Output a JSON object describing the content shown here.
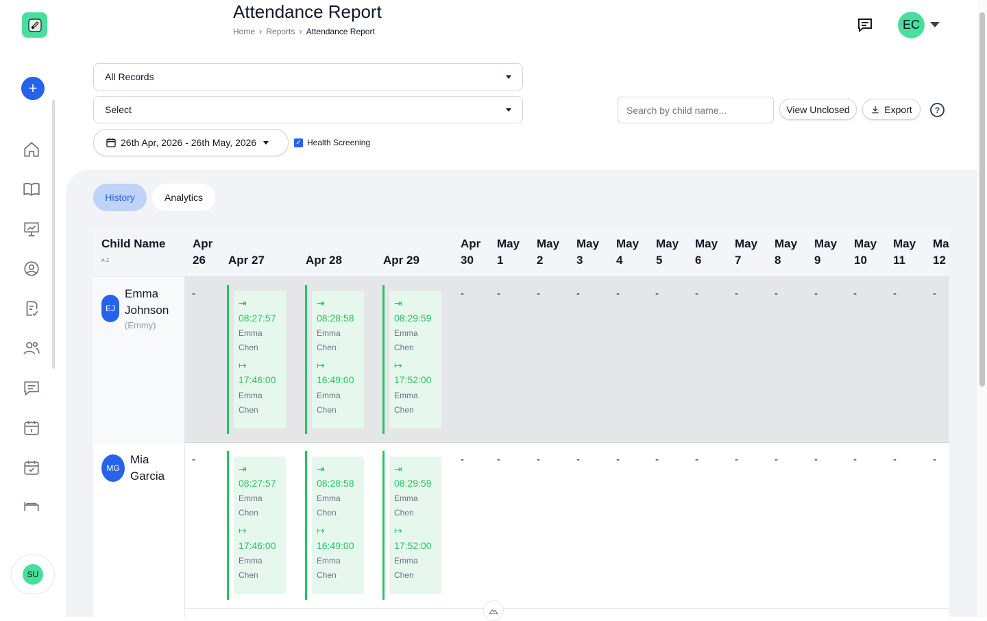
{
  "header": {
    "title": "Attendance Report",
    "breadcrumb": [
      "Home",
      "Reports",
      "Attendance Report"
    ],
    "user_initials": "EC"
  },
  "filters": {
    "records_select": "All Records",
    "class_select": "Select",
    "date_range": "26th Apr, 2026 - 26th May, 2026",
    "health_screening_label": "Health Screening",
    "health_screening_checked": true,
    "search_placeholder": "Search by child name...",
    "view_unclosed_label": "View Unclosed",
    "export_label": "Export"
  },
  "tabs": [
    "History",
    "Analytics"
  ],
  "table": {
    "name_header": "Child Name",
    "sort_hint": "A-Z",
    "columns": [
      "Apr\n26",
      "Apr 27",
      "Apr 28",
      "Apr 29",
      "Apr\n30",
      "May\n1",
      "May\n2",
      "May\n3",
      "May\n4",
      "May\n5",
      "May\n6",
      "May\n7",
      "May\n8",
      "May\n9",
      "May\n10",
      "May\n11",
      "Ma\n12"
    ],
    "rows": [
      {
        "initials": "EJ",
        "name": "Emma\nJohnson",
        "nickname": "(Emmy)",
        "records": [
          {
            "in": "08:27:57",
            "in_by": "Emma\nChen",
            "out": "17:46:00",
            "out_by": "Emma\nChen"
          },
          {
            "in": "08:28:58",
            "in_by": "Emma\nChen",
            "out": "16:49:00",
            "out_by": "Emma\nChen"
          },
          {
            "in": "08:29:59",
            "in_by": "Emma\nChen",
            "out": "17:52:00",
            "out_by": "Emma\nChen"
          }
        ]
      },
      {
        "initials": "MG",
        "name": "Mia\nGarcia",
        "nickname": "",
        "records": [
          {
            "in": "08:27:57",
            "in_by": "Emma\nChen",
            "out": "17:46:00",
            "out_by": "Emma\nChen"
          },
          {
            "in": "08:28:58",
            "in_by": "Emma\nChen",
            "out": "16:49:00",
            "out_by": "Emma\nChen"
          },
          {
            "in": "08:29:59",
            "in_by": "Emma\nChen",
            "out": "17:52:00",
            "out_by": "Emma\nChen"
          }
        ]
      }
    ],
    "empty_marker": "-"
  },
  "sidebar": {
    "icons": [
      "home-icon",
      "book-icon",
      "presentation-icon",
      "user-circle-icon",
      "clipboard-check-icon",
      "users-icon",
      "message-icon",
      "calendar-icon",
      "calendar-check-icon",
      "bed-icon"
    ],
    "user_initials": "SU"
  },
  "colors": {
    "accent": "#2563eb",
    "success": "#22c55e",
    "brand": "#4ade9e"
  }
}
